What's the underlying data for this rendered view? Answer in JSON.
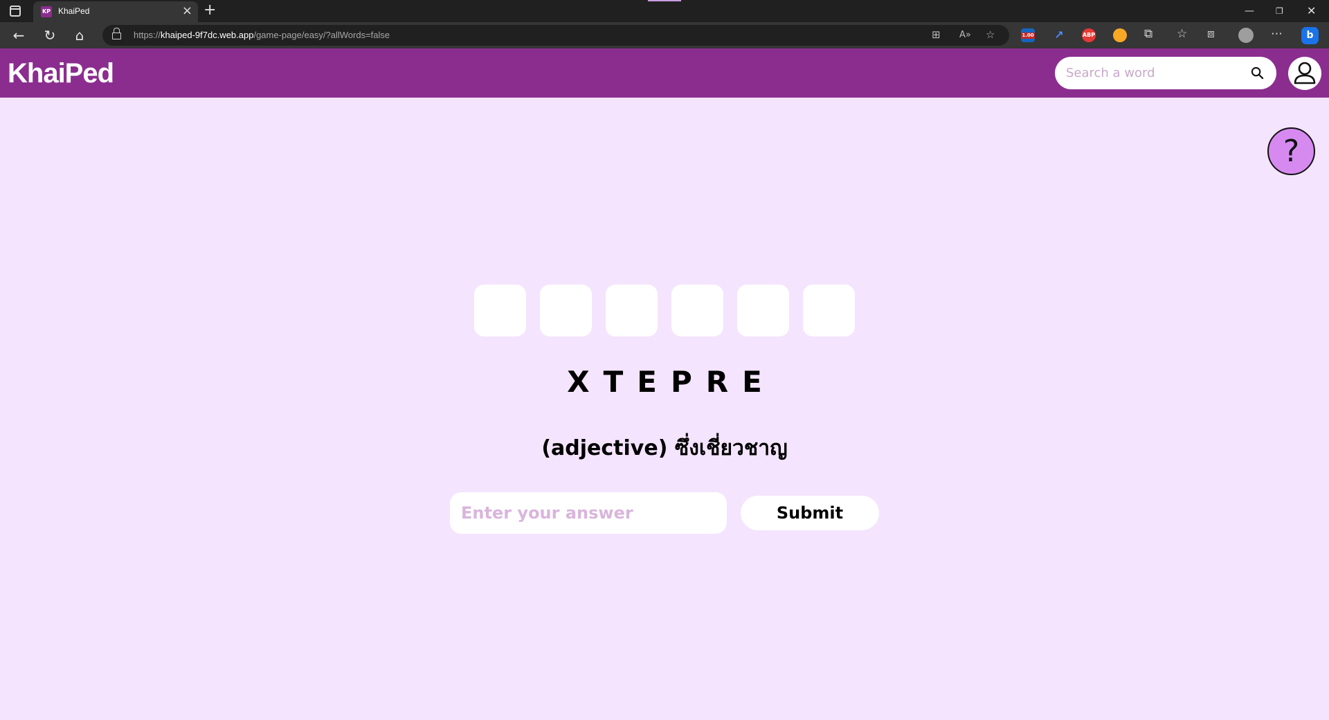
{
  "browser": {
    "tab_title": "KhaiPed",
    "tab_favicon_text": "KP",
    "url_scheme": "https://",
    "url_host": "khaiped-9f7dc.web.app",
    "url_path": "/game-page/easy/?allWords=false",
    "extension_badge": "1.00",
    "extension_abp_label": "ABP"
  },
  "header": {
    "logo": "KhaiPed",
    "search_placeholder": "Search a word",
    "brand_color": "#8b2d8f"
  },
  "game": {
    "help_label": "?",
    "letter_slots": [
      "",
      "",
      "",
      "",
      "",
      ""
    ],
    "scrambled_word": "XTEPRE",
    "definition": "(adjective) ซึ่งเชี่ยวชาญ",
    "answer_placeholder": "Enter your answer",
    "submit_label": "Submit"
  },
  "icons": [
    "sidebar-icon",
    "close-icon",
    "plus-icon",
    "back-arrow-icon",
    "reload-icon",
    "home-icon",
    "lock-icon",
    "search-icon",
    "user-icon",
    "help-icon"
  ]
}
